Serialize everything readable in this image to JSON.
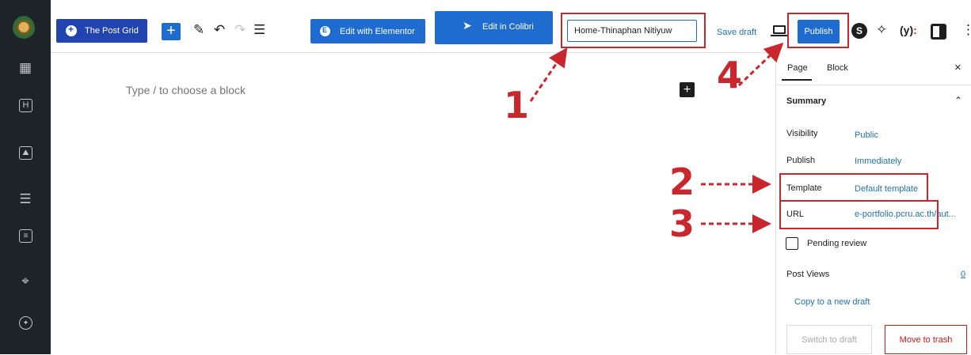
{
  "toolbar": {
    "post_grid_label": "The Post Grid",
    "add_symbol": "+",
    "elementor_label": "Edit with Elementor",
    "colibri_label": "Edit in Colibri",
    "title_value": "Home-Thinaphan Nitiyuw",
    "save_draft_label": "Save draft",
    "publish_label": "Publish",
    "more_symbol": "⋮"
  },
  "editor": {
    "placeholder": "Type / to choose a block",
    "inserter_symbol": "+"
  },
  "panel": {
    "tabs": [
      "Page",
      "Block"
    ],
    "close_symbol": "×",
    "summary_label": "Summary",
    "rows": [
      {
        "label": "Visibility",
        "value": "Public"
      },
      {
        "label": "Publish",
        "value": "Immediately"
      },
      {
        "label": "Template",
        "value": "Default template"
      },
      {
        "label": "URL",
        "value": "e-portfolio.pcru.ac.th/aut..."
      }
    ],
    "pending_review_label": "Pending review",
    "post_views_label": "Post Views",
    "post_views_count": "0",
    "copy_draft_label": "Copy to a new draft",
    "switch_draft_label": "Switch to draft",
    "move_trash_label": "Move to trash"
  },
  "annotations": {
    "steps": [
      "1",
      "2",
      "3",
      "4"
    ],
    "color": "#c8282d"
  },
  "icons": {
    "sidebar": [
      "site-logo-icon",
      "blocks-icon",
      "heading-icon",
      "image-icon",
      "stack-icon",
      "list-icon",
      "cursor-click-icon",
      "star-badge-icon"
    ],
    "toolbar": [
      "post-grid-icon",
      "plus-icon",
      "pencil-icon",
      "undo-icon",
      "redo-icon",
      "list-view-icon",
      "elementor-icon",
      "colibri-bird-icon",
      "preview-icon",
      "s-icon",
      "sparkle-icon",
      "yoast-icon",
      "settings-panel-icon",
      "more-icon"
    ]
  },
  "colors": {
    "accent": "#1e6ccf",
    "sidebar_bg": "#1d2327",
    "link": "#2271b1",
    "danger": "#cc1818"
  }
}
